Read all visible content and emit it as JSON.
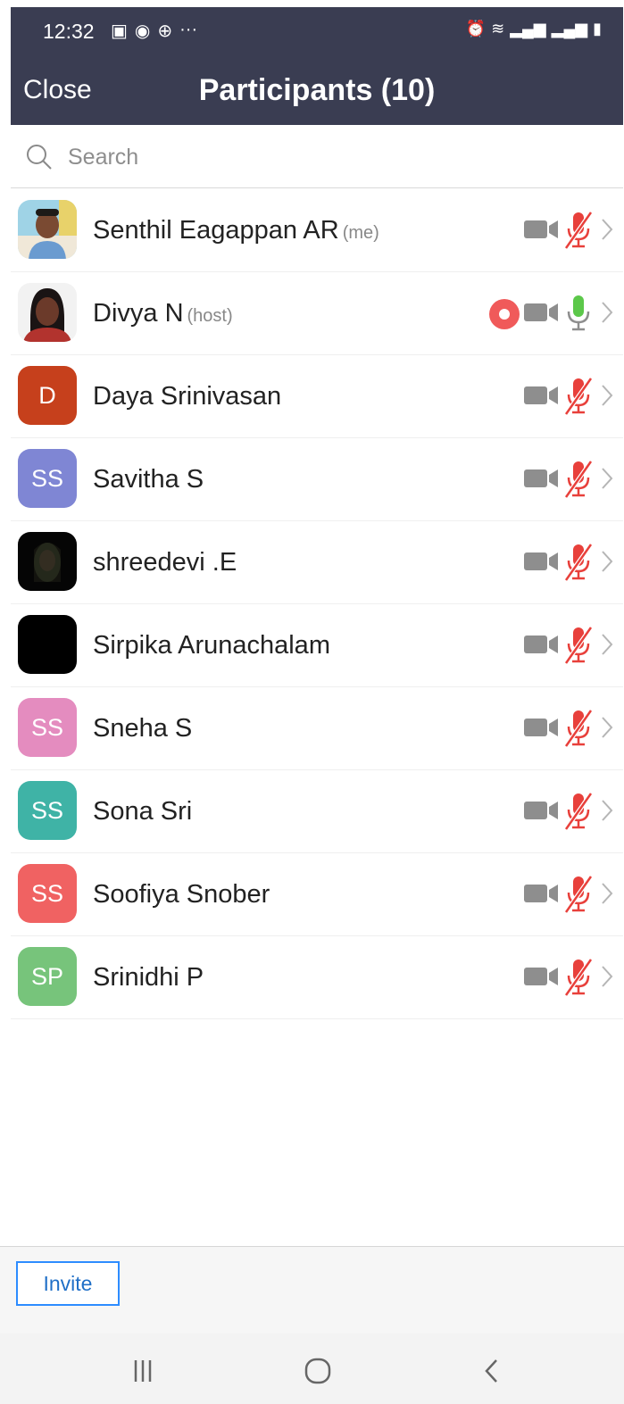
{
  "status_bar": {
    "time": "12:32",
    "more": "···"
  },
  "header": {
    "close_label": "Close",
    "title": "Participants (10)"
  },
  "search": {
    "placeholder": "Search"
  },
  "participants": [
    {
      "name": "Senthil Eagappan AR",
      "tag": "(me)",
      "avatar_type": "photo",
      "video": "off",
      "audio": "muted"
    },
    {
      "name": "Divya N",
      "tag": "(host)",
      "avatar_type": "photo",
      "recording": true,
      "video": "off",
      "audio": "unmuted"
    },
    {
      "name": "Daya Srinivasan",
      "tag": "",
      "avatar_initials": "D",
      "avatar_color": "#c6401c",
      "video": "off",
      "audio": "muted"
    },
    {
      "name": "Savitha S",
      "tag": "",
      "avatar_initials": "SS",
      "avatar_color": "#7f86d4",
      "video": "off",
      "audio": "muted"
    },
    {
      "name": "shreedevi .E",
      "tag": "",
      "avatar_type": "photo",
      "video": "off",
      "audio": "muted"
    },
    {
      "name": "Sirpika Arunachalam",
      "tag": "",
      "avatar_type": "black",
      "video": "off",
      "audio": "muted"
    },
    {
      "name": "Sneha S",
      "tag": "",
      "avatar_initials": "SS",
      "avatar_color": "#e48cbf",
      "video": "off",
      "audio": "muted"
    },
    {
      "name": "Sona Sri",
      "tag": "",
      "avatar_initials": "SS",
      "avatar_color": "#3fb3a6",
      "video": "off",
      "audio": "muted"
    },
    {
      "name": "Soofiya Snober",
      "tag": "",
      "avatar_initials": "SS",
      "avatar_color": "#f06262",
      "video": "off",
      "audio": "muted"
    },
    {
      "name": "Srinidhi P",
      "tag": "",
      "avatar_initials": "SP",
      "avatar_color": "#77c47b",
      "video": "off",
      "audio": "muted"
    }
  ],
  "footer": {
    "invite_label": "Invite"
  },
  "colors": {
    "header_bg": "#3a3d52",
    "muted_red": "#e8403b",
    "unmuted_green": "#5cc84a",
    "accent_blue": "#2d8cff"
  }
}
